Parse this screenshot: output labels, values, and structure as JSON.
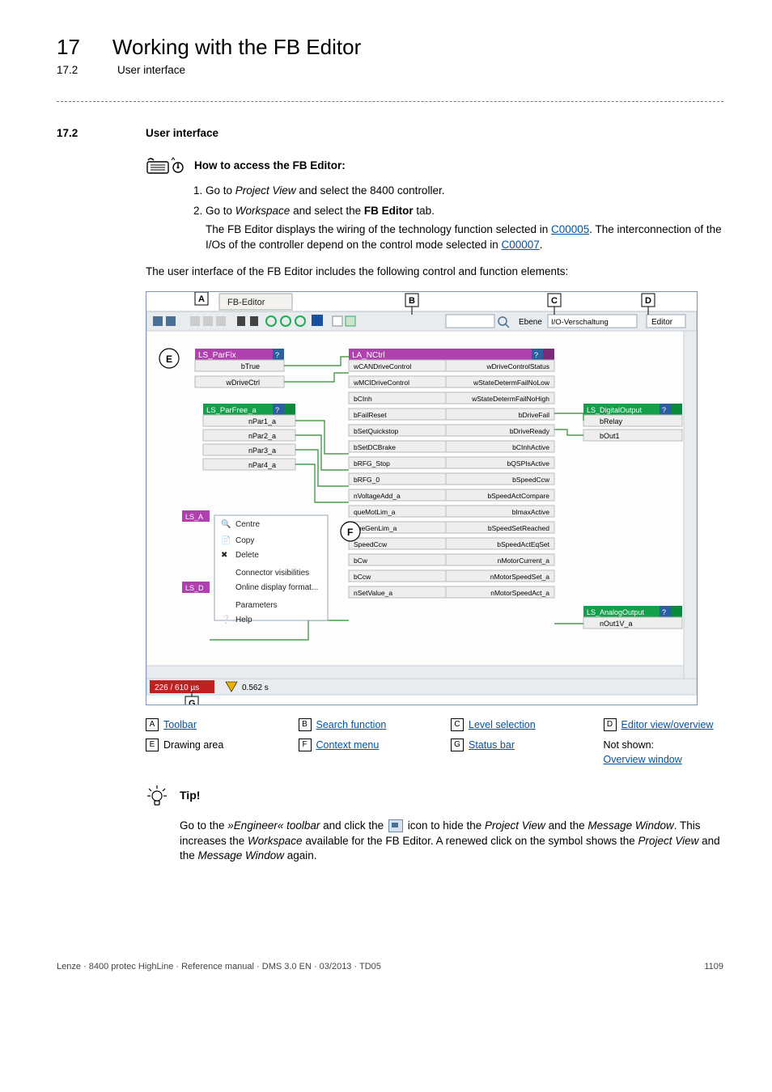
{
  "chapter": {
    "number": "17",
    "title": "Working with the FB Editor"
  },
  "subheader": {
    "number": "17.2",
    "title": "User interface"
  },
  "section": {
    "number": "17.2",
    "title": "User interface"
  },
  "howto": {
    "title": "How to access the FB Editor:",
    "step1": {
      "prefix": "Go to ",
      "italic": "Project View",
      "suffix": " and select the 8400 controller."
    },
    "step2": {
      "prefix": "Go to ",
      "italic": "Workspace",
      "mid": " and select the ",
      "bold": "FB Editor",
      "suffix": " tab."
    },
    "step2_body": {
      "t1": "The FB Editor displays the wiring of the technology function selected in ",
      "link1": "C00005",
      "t2": ". The interconnection of the I/Os of the controller depend on the control mode selected in ",
      "link2": "C00007",
      "t3": "."
    }
  },
  "intro_para": "The user interface of the FB Editor includes the following control and function elements:",
  "legend": {
    "A": {
      "letter": "A",
      "text": "Toolbar",
      "link": true
    },
    "B": {
      "letter": "B",
      "text": "Search function",
      "link": true
    },
    "C": {
      "letter": "C",
      "text": "Level selection",
      "link": true
    },
    "D": {
      "letter": "D",
      "text": "Editor view/overview",
      "link": true
    },
    "E": {
      "letter": "E",
      "text": "Drawing area",
      "link": false
    },
    "F": {
      "letter": "F",
      "text": "Context menu",
      "link": true
    },
    "G": {
      "letter": "G",
      "text": "Status bar",
      "link": true
    },
    "NS": {
      "label": "Not shown:",
      "text": "Overview window"
    }
  },
  "tip": {
    "title": "Tip!",
    "t1": "Go to the ",
    "italic1": "»Engineer« toolbar",
    "t2": " and click the ",
    "t3": " icon to hide the ",
    "italic2": "Project View",
    "t4": " and the ",
    "italic3": "Message Window",
    "t5": ". This increases the ",
    "italic4": "Workspace",
    "t6": " available for the FB Editor. A renewed click on the symbol shows the ",
    "italic5": "Project View",
    "t7": " and the ",
    "italic6": "Message Window",
    "t8": " again."
  },
  "screenshot": {
    "tab_label": "FB-Editor",
    "level_label": "Ebene",
    "level_value": "I/O-Verschaltung",
    "editor_label": "Editor",
    "statusbar": {
      "left": "226 / 610 µs",
      "warn": "0.562 s"
    },
    "blocks": {
      "ls_parfix": {
        "title": "LS_ParFix",
        "ports": [
          "bTrue",
          "wDriveCtrl"
        ]
      },
      "ls_parfree": {
        "title": "LS_ParFree_a",
        "ports": [
          "nPar1_a",
          "nPar2_a",
          "nPar3_a",
          "nPar4_a"
        ]
      },
      "ls_a": {
        "title": "LS_A"
      },
      "ls_d": {
        "title": "LS_D"
      },
      "la_nctrl": {
        "title": "LA_NCtrl",
        "ports_left": [
          "wCANDriveControl",
          "wMCIDriveControl",
          "bCInh",
          "bFailReset",
          "bSetQuickstop",
          "bSetDCBrake",
          "bRFG_Stop",
          "bRFG_0",
          "nVoltageAdd_a",
          "queMotLim_a",
          "queGenLim_a",
          "SpeedCcw",
          "bCw",
          "bCcw",
          "nSetValue_a"
        ],
        "ports_right": [
          "wDriveControlStatus",
          "wStateDetermFailNoLow",
          "wStateDetermFailNoHigh",
          "bDriveFail",
          "bDriveReady",
          "bCInhActive",
          "bQSPIsActive",
          "bSpeedCcw",
          "bSpeedActCompare",
          "bImaxActive",
          "bSpeedSetReached",
          "bSpeedActEqSet",
          "nMotorCurrent_a",
          "nMotorSpeedSet_a",
          "nMotorSpeedAct_a"
        ]
      },
      "ls_digital": {
        "title": "LS_DigitalOutput",
        "ports": [
          "bRelay",
          "bOut1"
        ]
      },
      "ls_analog": {
        "title": "LS_AnalogOutput",
        "ports": [
          "nOut1V_a"
        ]
      }
    },
    "context_menu": [
      "Centre",
      "Copy",
      "Delete",
      "Connector visibilities",
      "Online display format...",
      "Parameters",
      "Help"
    ]
  },
  "footer": {
    "left": "Lenze · 8400 protec HighLine · Reference manual · DMS 3.0 EN · 03/2013 · TD05",
    "right": "1109"
  }
}
